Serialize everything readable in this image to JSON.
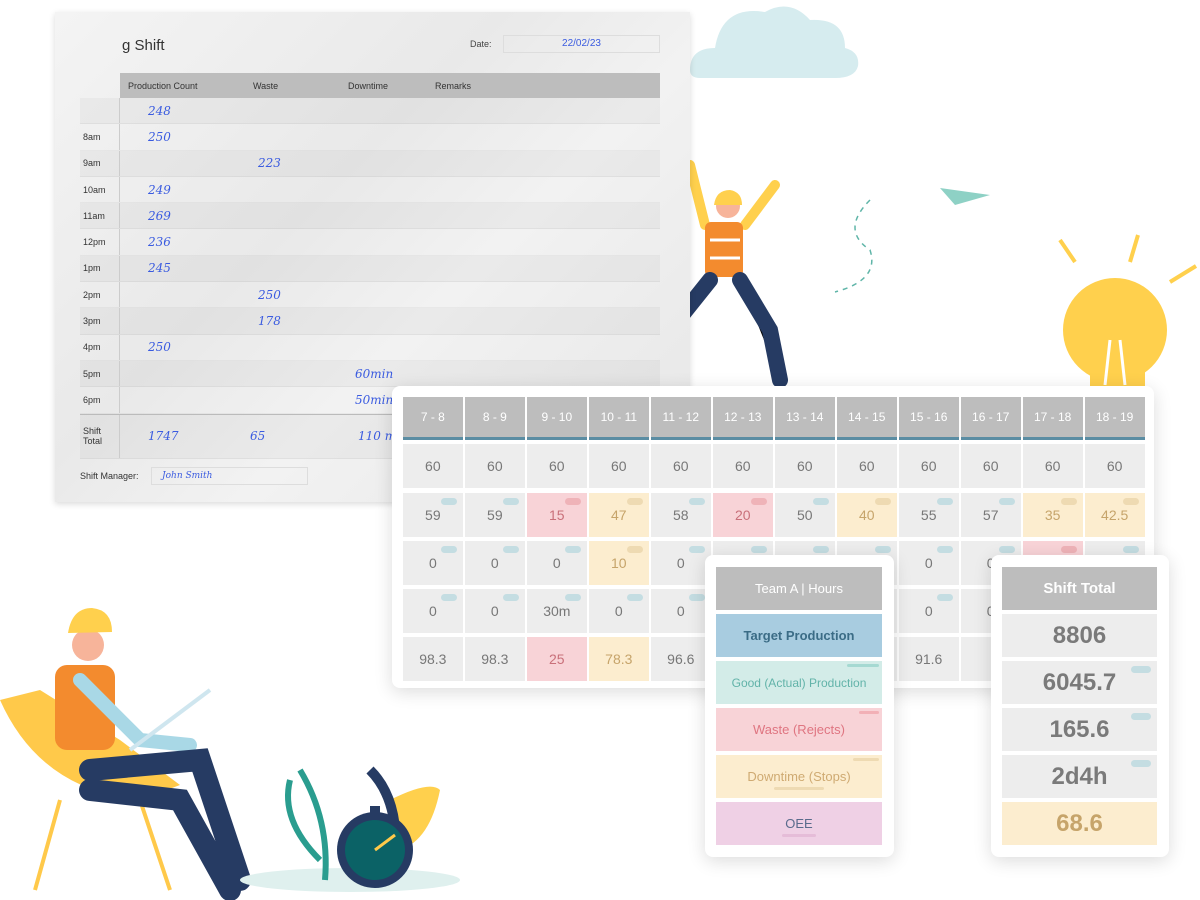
{
  "paper_form": {
    "title": "g Shift",
    "date_label": "Date:",
    "date_value": "22/02/23",
    "columns": [
      "Production Count",
      "Waste",
      "Downtime",
      "Remarks"
    ],
    "rows": [
      {
        "label": "",
        "production": "248",
        "waste": "",
        "downtime": ""
      },
      {
        "label": "8am",
        "production": "250",
        "waste": "",
        "downtime": ""
      },
      {
        "label": "9am",
        "production": "",
        "waste": "223",
        "downtime": ""
      },
      {
        "label": "10am",
        "production": "249",
        "waste": "",
        "downtime": ""
      },
      {
        "label": "11am",
        "production": "269",
        "waste": "",
        "downtime": ""
      },
      {
        "label": "12pm",
        "production": "236",
        "waste": "",
        "downtime": ""
      },
      {
        "label": "1pm",
        "production": "245",
        "waste": "",
        "downtime": ""
      },
      {
        "label": "2pm",
        "production": "",
        "waste": "250",
        "downtime": ""
      },
      {
        "label": "3pm",
        "production": "",
        "waste": "178",
        "downtime": ""
      },
      {
        "label": "4pm",
        "production": "250",
        "waste": "",
        "downtime": ""
      },
      {
        "label": "5pm",
        "production": "",
        "waste": "",
        "downtime": "60min"
      },
      {
        "label": "6pm",
        "production": "",
        "waste": "",
        "downtime": "50min"
      }
    ],
    "total": {
      "label": "Shift Total",
      "production": "1747",
      "waste": "65",
      "downtime": "110 min"
    },
    "manager_label": "Shift Manager:",
    "manager_value": "John Smith"
  },
  "hourly_grid": {
    "hours": [
      "7 - 8",
      "8 - 9",
      "9 - 10",
      "10 - 11",
      "11 - 12",
      "12 - 13",
      "13 - 14",
      "14 - 15",
      "15 - 16",
      "16 - 17",
      "17 - 18",
      "18 - 19"
    ],
    "rows": [
      [
        {
          "v": "60"
        },
        {
          "v": "60"
        },
        {
          "v": "60"
        },
        {
          "v": "60"
        },
        {
          "v": "60"
        },
        {
          "v": "60"
        },
        {
          "v": "60"
        },
        {
          "v": "60"
        },
        {
          "v": "60"
        },
        {
          "v": "60"
        },
        {
          "v": "60"
        },
        {
          "v": "60"
        }
      ],
      [
        {
          "v": "59"
        },
        {
          "v": "59"
        },
        {
          "v": "15",
          "s": "red"
        },
        {
          "v": "47",
          "s": "yel"
        },
        {
          "v": "58"
        },
        {
          "v": "20",
          "s": "red"
        },
        {
          "v": "50"
        },
        {
          "v": "40",
          "s": "yel"
        },
        {
          "v": "55"
        },
        {
          "v": "57"
        },
        {
          "v": "35",
          "s": "yel"
        },
        {
          "v": "42.5",
          "s": "yel"
        }
      ],
      [
        {
          "v": "0"
        },
        {
          "v": "0"
        },
        {
          "v": "0"
        },
        {
          "v": "10",
          "s": "yel"
        },
        {
          "v": "0"
        },
        {
          "v": ""
        },
        {
          "v": ""
        },
        {
          "v": ""
        },
        {
          "v": "0"
        },
        {
          "v": "0"
        },
        {
          "v": "",
          "s": "red"
        },
        {
          "v": ""
        }
      ],
      [
        {
          "v": "0"
        },
        {
          "v": "0"
        },
        {
          "v": "30m"
        },
        {
          "v": "0"
        },
        {
          "v": "0"
        },
        {
          "v": ""
        },
        {
          "v": ""
        },
        {
          "v": ""
        },
        {
          "v": "0"
        },
        {
          "v": "0"
        },
        {
          "v": ""
        },
        {
          "v": ""
        }
      ],
      [
        {
          "v": "98.3"
        },
        {
          "v": "98.3"
        },
        {
          "v": "25",
          "s": "red"
        },
        {
          "v": "78.3",
          "s": "yel"
        },
        {
          "v": "96.6"
        },
        {
          "v": ""
        },
        {
          "v": ""
        },
        {
          "v": ""
        },
        {
          "v": "91.6"
        },
        {
          "v": ""
        },
        {
          "v": ""
        },
        {
          "v": ""
        }
      ]
    ]
  },
  "team_panel": {
    "header": "Team A | Hours",
    "items": [
      "Target Production",
      "Good (Actual) Production",
      "Waste (Rejects)",
      "Downtime (Stops)",
      "OEE"
    ]
  },
  "shift_total_panel": {
    "header": "Shift Total",
    "values": [
      "8806",
      "6045.7",
      "165.6",
      "2d4h",
      "68.6"
    ]
  },
  "colors": {
    "target": "#a8cce0",
    "good": "#d3ece8",
    "waste": "#f8d3d7",
    "downtime": "#fcedcf",
    "oee": "#efd0e5",
    "header": "#bdbdbd",
    "accent": "#5b8da3"
  }
}
